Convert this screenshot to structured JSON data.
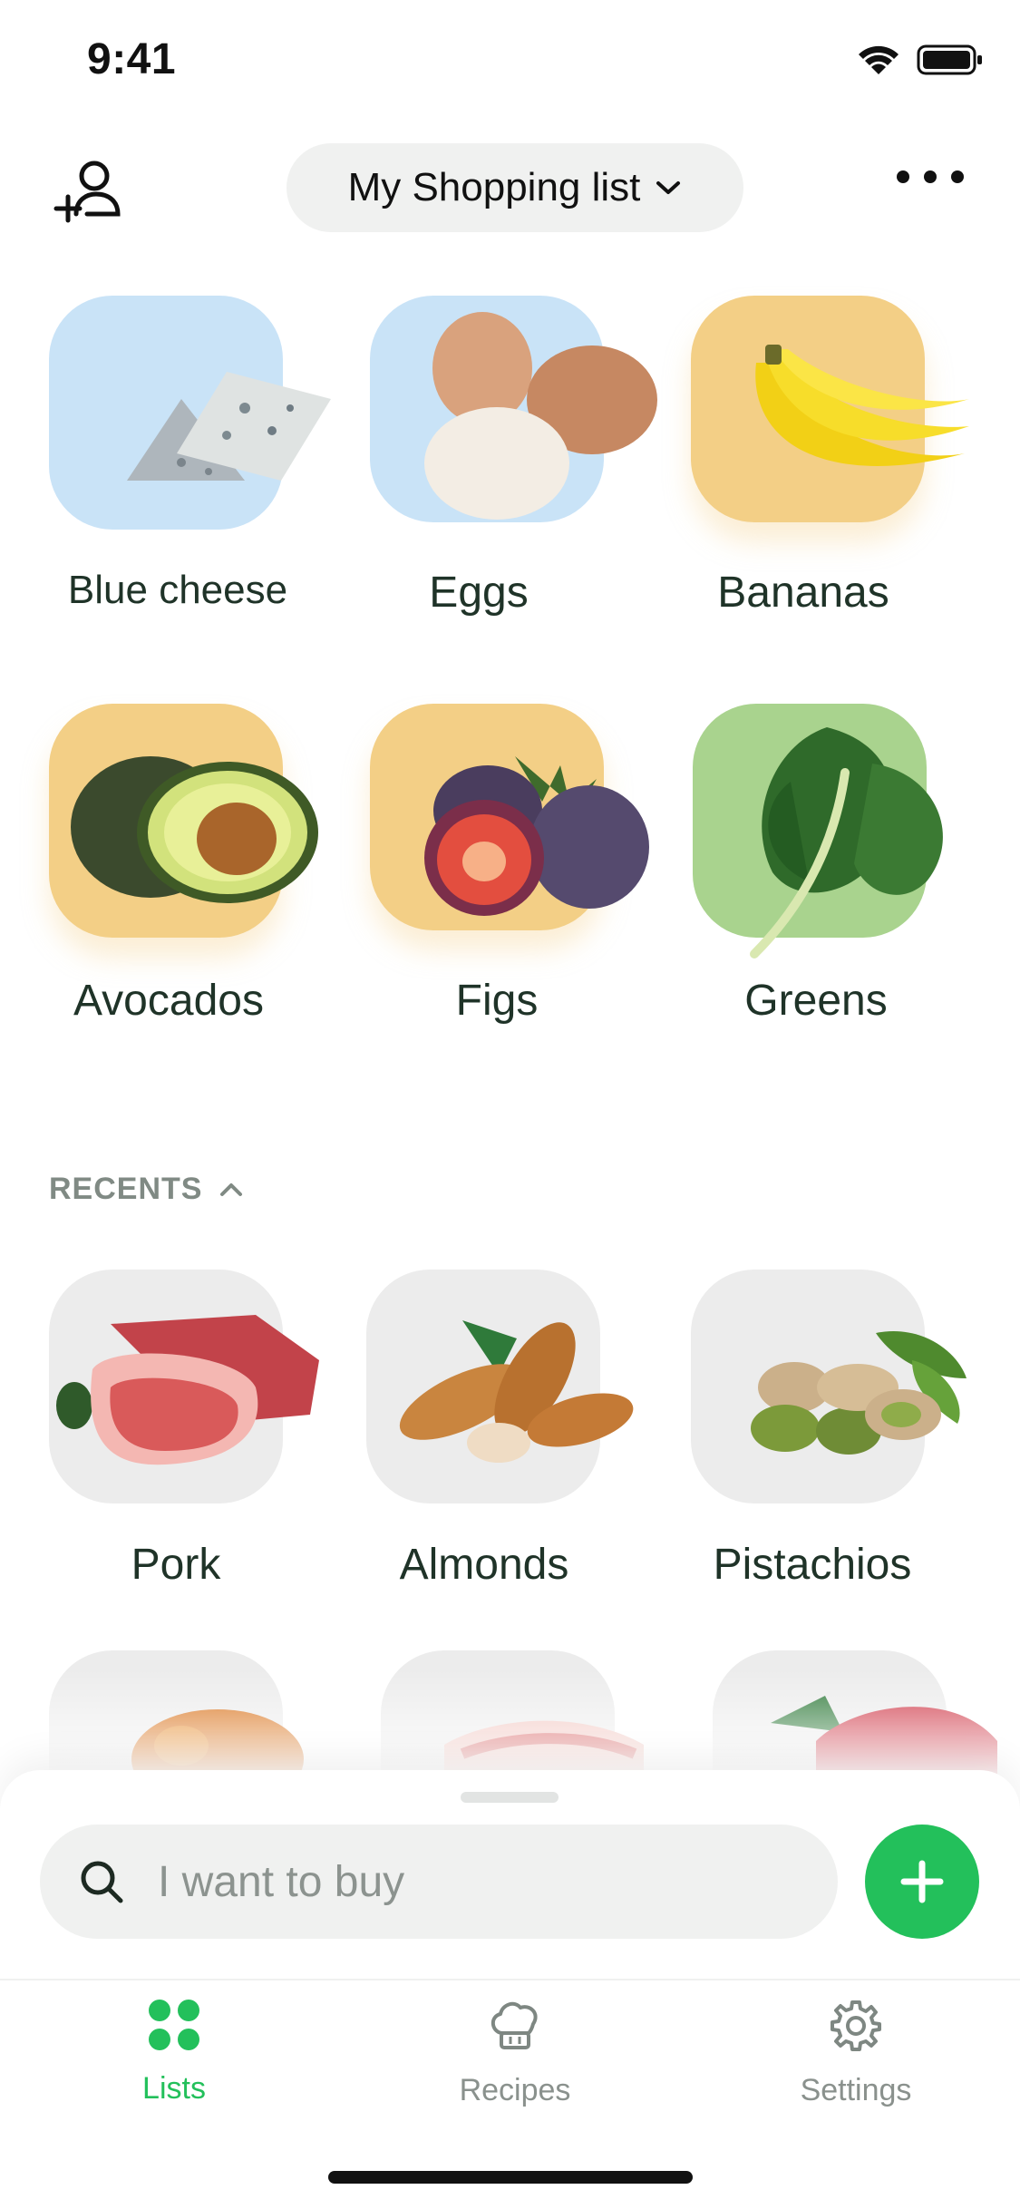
{
  "status_bar": {
    "time": "9:41"
  },
  "header": {
    "list_title": "My Shopping list"
  },
  "favorites": [
    {
      "label": "Blue cheese",
      "bg": "#c9e3f7"
    },
    {
      "label": "Eggs",
      "bg": "#c9e3f7"
    },
    {
      "label": "Bananas",
      "bg": "#f3cf86"
    },
    {
      "label": "Avocados",
      "bg": "#f3cf86"
    },
    {
      "label": "Figs",
      "bg": "#f3cf86"
    },
    {
      "label": "Greens",
      "bg": "#a9d38e"
    }
  ],
  "recents": {
    "heading": "RECENTS",
    "items": [
      {
        "label": "Pork"
      },
      {
        "label": "Almonds"
      },
      {
        "label": "Pistachios"
      }
    ]
  },
  "search": {
    "placeholder": "I want to buy"
  },
  "tabs": [
    {
      "label": "Lists",
      "icon": "grid-icon",
      "active": true
    },
    {
      "label": "Recipes",
      "icon": "chef-hat-icon",
      "active": false
    },
    {
      "label": "Settings",
      "icon": "gear-icon",
      "active": false
    }
  ],
  "colors": {
    "accent": "#23c05b",
    "text": "#1f3328",
    "muted": "#808a84"
  }
}
